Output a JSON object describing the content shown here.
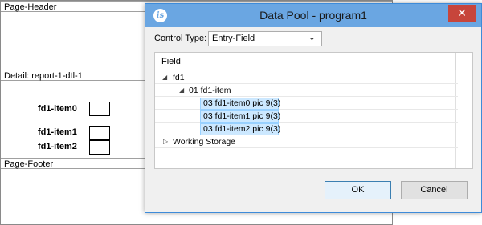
{
  "designer": {
    "bands": [
      {
        "label": "Page-Header"
      },
      {
        "label": "Detail: report-1-dtl-1"
      },
      {
        "label": "Page-Footer"
      }
    ],
    "fields": [
      {
        "label": "fd1-item0"
      },
      {
        "label": "fd1-item1"
      },
      {
        "label": "fd1-item2"
      }
    ]
  },
  "dialog": {
    "app_icon": "is",
    "title": "Data Pool - program1",
    "close_glyph": "✕",
    "control_type": {
      "label": "Control Type:",
      "value": "Entry-Field",
      "chevron": "⌄"
    },
    "tree": {
      "column_header": "Field",
      "rows": [
        {
          "text": "fd1",
          "expander": "◢"
        },
        {
          "text": "01 fd1-item",
          "expander": "◢"
        },
        {
          "text": "03 fd1-item0 pic 9(3)"
        },
        {
          "text": "03 fd1-item1 pic 9(3)"
        },
        {
          "text": "03 fd1-item2 pic 9(3)"
        },
        {
          "text": "Working Storage",
          "expander": "▷"
        }
      ]
    },
    "buttons": {
      "ok": "OK",
      "cancel": "Cancel"
    }
  }
}
